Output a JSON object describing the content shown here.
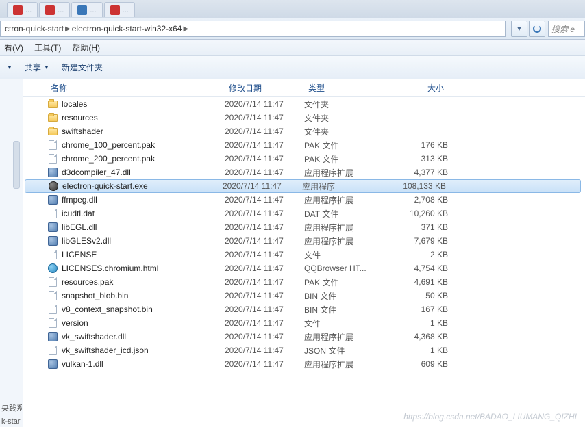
{
  "browser_tabs": [
    {
      "label": "...",
      "icon": "red"
    },
    {
      "label": "...",
      "icon": "red"
    },
    {
      "label": "...",
      "icon": "blue"
    },
    {
      "label": "...",
      "icon": "red"
    }
  ],
  "breadcrumbs": [
    "ctron-quick-start",
    "electron-quick-start-win32-x64"
  ],
  "search_placeholder": "搜索 e",
  "menus": {
    "view": "看(V)",
    "tools": "工具(T)",
    "help": "帮助(H)"
  },
  "toolbar": {
    "share": "共享",
    "new_folder": "新建文件夹"
  },
  "columns": {
    "name": "名称",
    "date": "修改日期",
    "type": "类型",
    "size": "大小"
  },
  "left_frags": {
    "a": "央践系",
    "b": "k-star"
  },
  "watermark": "https://blog.csdn.net/BADAO_LIUMANG_QIZHI",
  "files": [
    {
      "icon": "folder",
      "name": "locales",
      "date": "2020/7/14 11:47",
      "type": "文件夹",
      "size": "",
      "selected": false
    },
    {
      "icon": "folder",
      "name": "resources",
      "date": "2020/7/14 11:47",
      "type": "文件夹",
      "size": "",
      "selected": false
    },
    {
      "icon": "folder",
      "name": "swiftshader",
      "date": "2020/7/14 11:47",
      "type": "文件夹",
      "size": "",
      "selected": false
    },
    {
      "icon": "file",
      "name": "chrome_100_percent.pak",
      "date": "2020/7/14 11:47",
      "type": "PAK 文件",
      "size": "176 KB",
      "selected": false
    },
    {
      "icon": "file",
      "name": "chrome_200_percent.pak",
      "date": "2020/7/14 11:47",
      "type": "PAK 文件",
      "size": "313 KB",
      "selected": false
    },
    {
      "icon": "dll",
      "name": "d3dcompiler_47.dll",
      "date": "2020/7/14 11:47",
      "type": "应用程序扩展",
      "size": "4,377 KB",
      "selected": false
    },
    {
      "icon": "exe",
      "name": "electron-quick-start.exe",
      "date": "2020/7/14 11:47",
      "type": "应用程序",
      "size": "108,133 KB",
      "selected": true
    },
    {
      "icon": "dll",
      "name": "ffmpeg.dll",
      "date": "2020/7/14 11:47",
      "type": "应用程序扩展",
      "size": "2,708 KB",
      "selected": false
    },
    {
      "icon": "file",
      "name": "icudtl.dat",
      "date": "2020/7/14 11:47",
      "type": "DAT 文件",
      "size": "10,260 KB",
      "selected": false
    },
    {
      "icon": "dll",
      "name": "libEGL.dll",
      "date": "2020/7/14 11:47",
      "type": "应用程序扩展",
      "size": "371 KB",
      "selected": false
    },
    {
      "icon": "dll",
      "name": "libGLESv2.dll",
      "date": "2020/7/14 11:47",
      "type": "应用程序扩展",
      "size": "7,679 KB",
      "selected": false
    },
    {
      "icon": "file",
      "name": "LICENSE",
      "date": "2020/7/14 11:47",
      "type": "文件",
      "size": "2 KB",
      "selected": false
    },
    {
      "icon": "html",
      "name": "LICENSES.chromium.html",
      "date": "2020/7/14 11:47",
      "type": "QQBrowser HT...",
      "size": "4,754 KB",
      "selected": false
    },
    {
      "icon": "file",
      "name": "resources.pak",
      "date": "2020/7/14 11:47",
      "type": "PAK 文件",
      "size": "4,691 KB",
      "selected": false
    },
    {
      "icon": "file",
      "name": "snapshot_blob.bin",
      "date": "2020/7/14 11:47",
      "type": "BIN 文件",
      "size": "50 KB",
      "selected": false
    },
    {
      "icon": "file",
      "name": "v8_context_snapshot.bin",
      "date": "2020/7/14 11:47",
      "type": "BIN 文件",
      "size": "167 KB",
      "selected": false
    },
    {
      "icon": "file",
      "name": "version",
      "date": "2020/7/14 11:47",
      "type": "文件",
      "size": "1 KB",
      "selected": false
    },
    {
      "icon": "dll",
      "name": "vk_swiftshader.dll",
      "date": "2020/7/14 11:47",
      "type": "应用程序扩展",
      "size": "4,368 KB",
      "selected": false
    },
    {
      "icon": "file",
      "name": "vk_swiftshader_icd.json",
      "date": "2020/7/14 11:47",
      "type": "JSON 文件",
      "size": "1 KB",
      "selected": false
    },
    {
      "icon": "dll",
      "name": "vulkan-1.dll",
      "date": "2020/7/14 11:47",
      "type": "应用程序扩展",
      "size": "609 KB",
      "selected": false
    }
  ]
}
